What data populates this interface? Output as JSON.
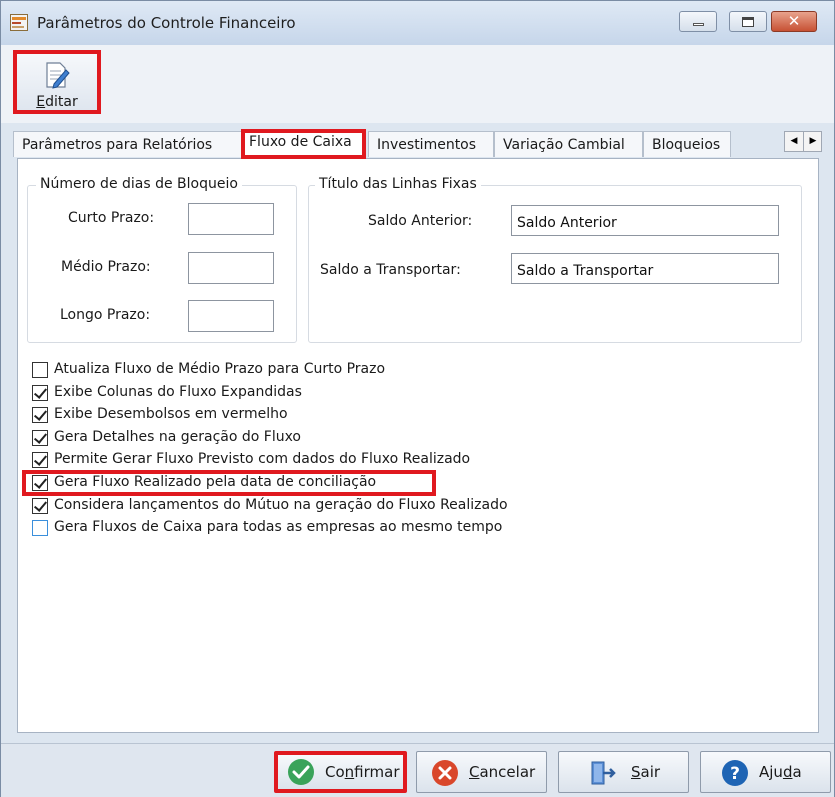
{
  "window": {
    "title": "Parâmetros do Controle Financeiro"
  },
  "toolbar": {
    "edit_label": "Editar",
    "edit_mnemonic": "E",
    "edit_rest": "ditar"
  },
  "tabs": [
    {
      "label": "Parâmetros para Relatórios",
      "active": false
    },
    {
      "label": "Fluxo de Caixa",
      "active": true
    },
    {
      "label": "Investimentos",
      "active": false
    },
    {
      "label": "Variação Cambial",
      "active": false
    },
    {
      "label": "Bloqueios",
      "active": false
    }
  ],
  "bloqueio": {
    "title": "Número de dias de Bloqueio",
    "curto_label": "Curto Prazo:",
    "curto_value": "",
    "medio_label": "Médio Prazo:",
    "medio_value": "",
    "longo_label": "Longo Prazo:",
    "longo_value": ""
  },
  "linhas_fixas": {
    "title": "Título das Linhas Fixas",
    "saldo_anterior_label": "Saldo Anterior:",
    "saldo_anterior_value": "Saldo Anterior",
    "saldo_transportar_label": "Saldo a Transportar:",
    "saldo_transportar_value": "Saldo a Transportar"
  },
  "options": [
    {
      "label": "Atualiza Fluxo de Médio Prazo para Curto Prazo",
      "checked": false
    },
    {
      "label": "Exibe Colunas do Fluxo Expandidas",
      "checked": true
    },
    {
      "label": "Exibe Desembolsos  em vermelho",
      "checked": true
    },
    {
      "label": "Gera Detalhes na geração do Fluxo",
      "checked": true
    },
    {
      "label": "Permite Gerar Fluxo Previsto com dados do Fluxo Realizado",
      "checked": true
    },
    {
      "label": "Gera Fluxo Realizado pela data de conciliação",
      "checked": true
    },
    {
      "label": "Considera lançamentos do Mútuo na geração do Fluxo Realizado",
      "checked": true
    },
    {
      "label": "Gera Fluxos de Caixa para todas as empresas ao mesmo tempo",
      "checked": false
    }
  ],
  "footer": {
    "confirm_pre": "Co",
    "confirm_mn": "n",
    "confirm_post": "firmar",
    "cancel_mn": "C",
    "cancel_post": "ancelar",
    "exit_mn": "S",
    "exit_post": "air",
    "help_pre": "Aju",
    "help_mn": "d",
    "help_post": "a"
  },
  "colors": {
    "highlight": "#e0191f",
    "confirm_icon": "#3aa35a",
    "cancel_icon": "#d9472b",
    "help_icon": "#1e64b4"
  }
}
